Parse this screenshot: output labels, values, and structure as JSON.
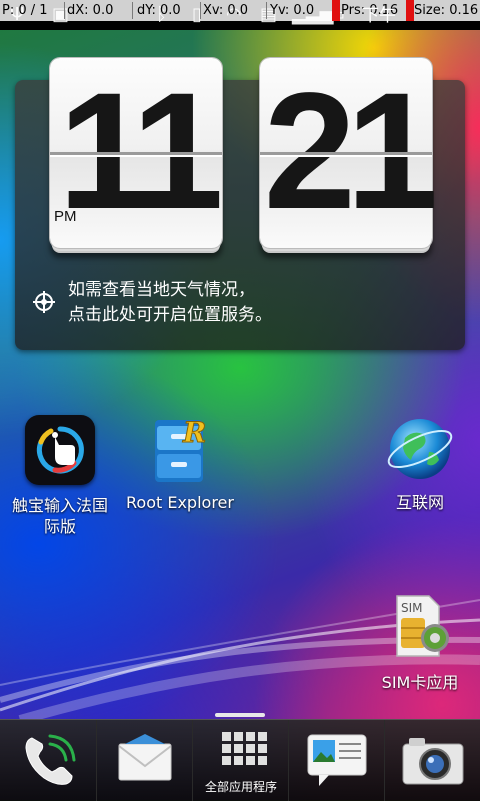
{
  "status_bar": {
    "pointer_info": {
      "p": "P: 0 / 1",
      "dx": "dX: 0.0",
      "dy": "dY: 0.0",
      "xv": "Xv: 0.0",
      "yv": "Yv: 0.0",
      "prs": "Prs: 0.16",
      "size": "Size: 0.16"
    },
    "time_period": "下午",
    "time": "11:21",
    "icons": [
      "usb-icon",
      "android-debug-icon",
      "bluetooth-icon",
      "vibrate-icon",
      "wifi-icon",
      "sd-card-icon",
      "signal-icon",
      "battery-icon"
    ]
  },
  "clock_widget": {
    "hours": "11",
    "minutes": "21",
    "period": "PM",
    "weather_line1": "如需查看当地天气情况，",
    "weather_line2": "点击此处可开启位置服务。"
  },
  "apps": [
    {
      "label_line1": "触宝输入法国",
      "label_line2": "际版",
      "icon": "chubao-keyboard-icon"
    },
    {
      "label": "Root Explorer",
      "icon": "root-explorer-icon"
    },
    {
      "label": "互联网",
      "icon": "globe-icon"
    },
    {
      "label": "SIM卡应用",
      "icon": "sim-card-icon"
    }
  ],
  "dock": {
    "phone": "phone-icon",
    "messages": "mail-icon",
    "all_apps_label": "全部应用程序",
    "gallery": "gallery-icon",
    "camera": "camera-icon"
  }
}
